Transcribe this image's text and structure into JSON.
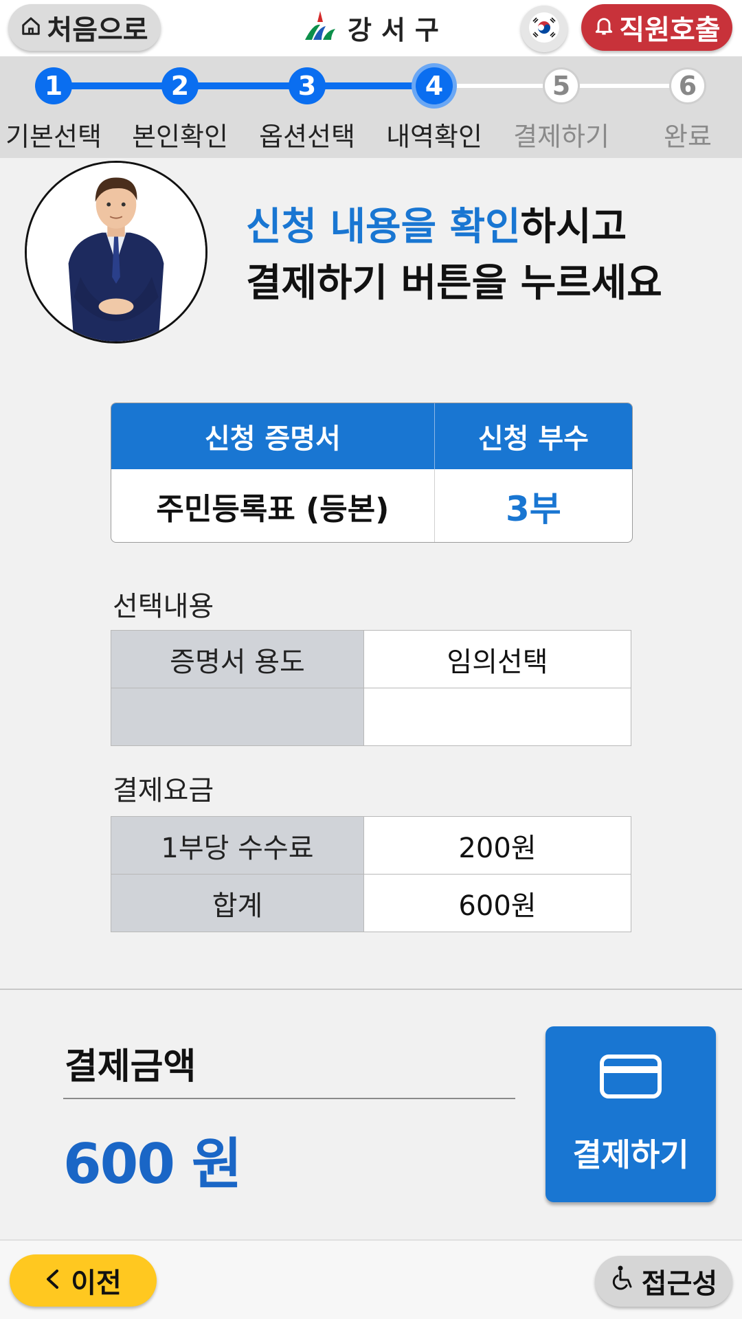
{
  "header": {
    "home_label": "처음으로",
    "logo_text": "강서구",
    "call_label": "직원호출"
  },
  "stepper": {
    "steps": [
      {
        "number": "1",
        "label": "기본선택",
        "state": "done"
      },
      {
        "number": "2",
        "label": "본인확인",
        "state": "done"
      },
      {
        "number": "3",
        "label": "옵션선택",
        "state": "done"
      },
      {
        "number": "4",
        "label": "내역확인",
        "state": "current"
      },
      {
        "number": "5",
        "label": "결제하기",
        "state": "todo"
      },
      {
        "number": "6",
        "label": "완료",
        "state": "todo"
      }
    ]
  },
  "instruction": {
    "highlight": "신청 내용을 확인",
    "rest_line1": "하시고",
    "line2": "결제하기 버튼을 누르세요"
  },
  "cert_table": {
    "headers": [
      "신청 증명서",
      "신청 부수"
    ],
    "row": [
      "주민등록표 (등본)",
      "3부"
    ]
  },
  "selection": {
    "title": "선택내용",
    "rows": [
      [
        "증명서 용도",
        "임의선택"
      ],
      [
        "",
        ""
      ]
    ]
  },
  "fees": {
    "title": "결제요금",
    "rows": [
      [
        "1부당 수수료",
        "200원"
      ],
      [
        "합계",
        "600원"
      ]
    ]
  },
  "payment": {
    "label": "결제금액",
    "amount": "600 원",
    "button_label": "결제하기"
  },
  "footer": {
    "prev_label": "이전",
    "access_label": "접근성"
  },
  "colors": {
    "accent": "#1976d2",
    "step_active": "#0a6ef0",
    "call": "#c8323a",
    "prev": "#ffc820"
  }
}
